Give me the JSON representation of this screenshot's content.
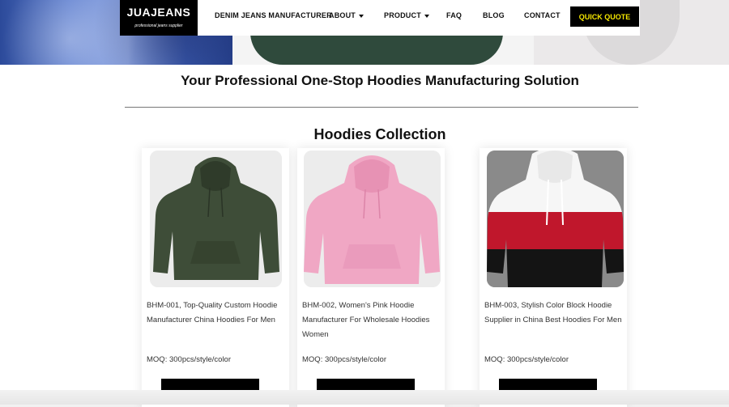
{
  "header": {
    "logo_text": "JUAJEANS",
    "logo_tagline": "professional jeans supplier",
    "nav": [
      {
        "label": "DENIM JEANS MANUFACTURER",
        "has_dropdown": false
      },
      {
        "label": "ABOUT",
        "has_dropdown": true
      },
      {
        "label": "PRODUCT",
        "has_dropdown": true
      },
      {
        "label": "FAQ",
        "has_dropdown": false
      },
      {
        "label": "BLOG",
        "has_dropdown": false
      },
      {
        "label": "CONTACT",
        "has_dropdown": false
      }
    ],
    "cta_label": "QUICK QUOTE"
  },
  "main": {
    "headline": "Your Professional One-Stop Hoodies Manufacturing Solution",
    "section_title": "Hoodies Collection",
    "products": [
      {
        "description": "BHM-001, Top-Quality Custom Hoodie Manufacturer China Hoodies For Men",
        "moq": "MOQ: 300pcs/style/color",
        "image": "green-hoodie"
      },
      {
        "description": "BHM-002, Women's Pink Hoodie Manufacturer For Wholesale Hoodies Women",
        "moq": "MOQ: 300pcs/style/color",
        "image": "pink-hoodie"
      },
      {
        "description": "BHM-003, Stylish Color Block Hoodie Supplier in China Best Hoodies For Men",
        "moq": "MOQ: 300pcs/style/color",
        "image": "colorblock-hoodie"
      }
    ]
  },
  "colors": {
    "accent_yellow": "#f4e600",
    "black": "#000000",
    "green_hoodie": "#3e4d38",
    "pink_hoodie": "#f0a7c4",
    "red_block": "#c0172c"
  }
}
